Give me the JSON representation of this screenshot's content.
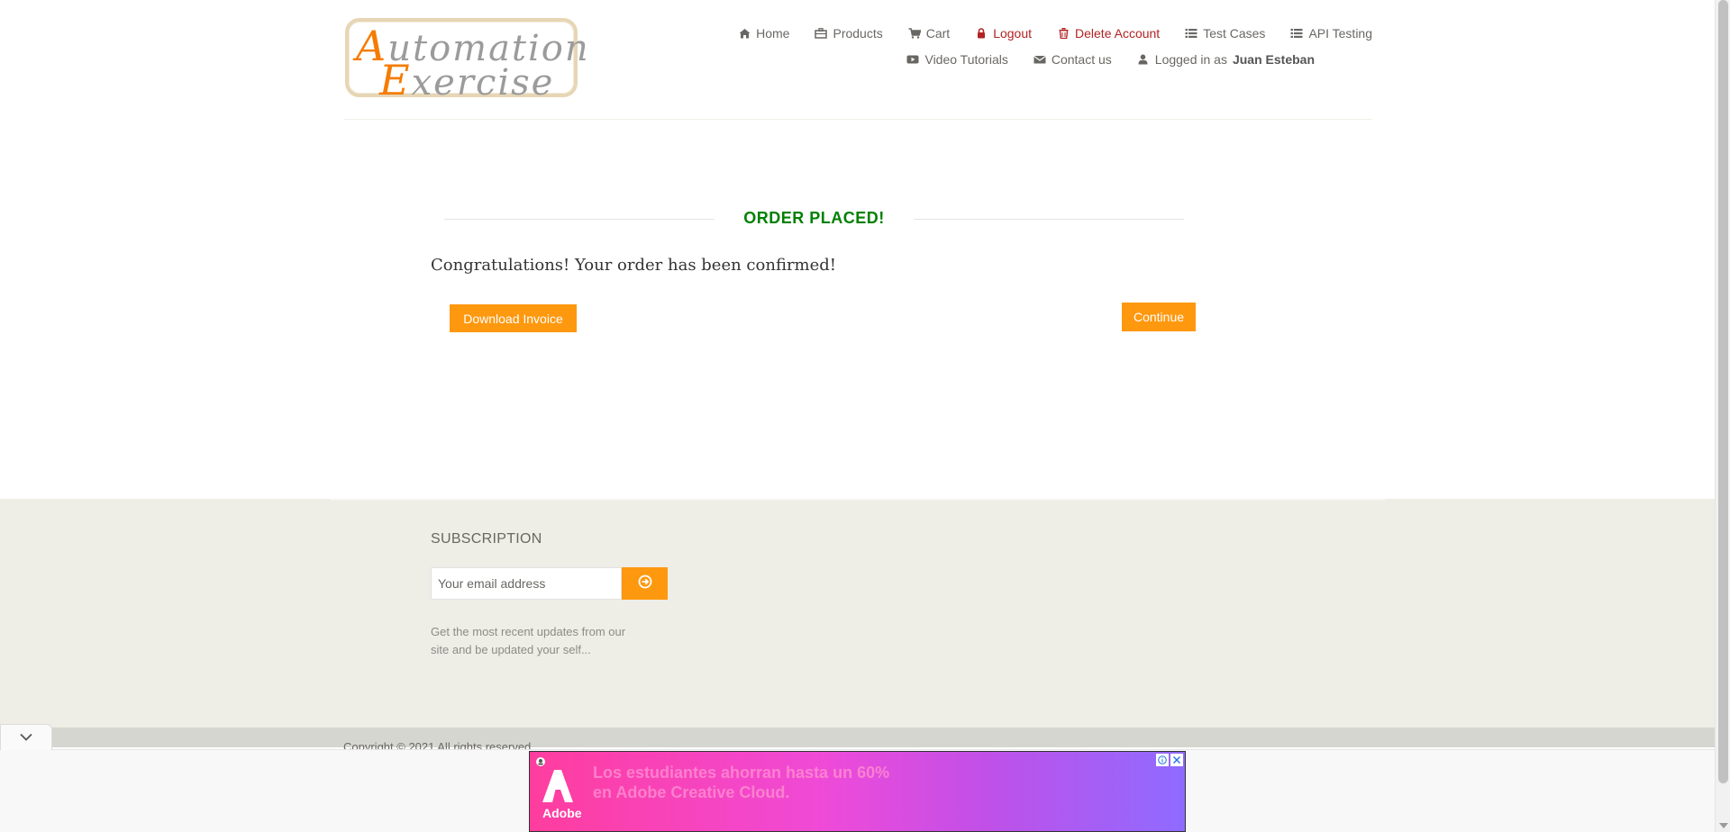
{
  "brand": {
    "logo_cap1": "A",
    "logo_rest1": "utomation",
    "logo_cap2": "E",
    "logo_rest2": "xercise"
  },
  "nav": {
    "row1": [
      {
        "label": "Home",
        "icon": "home-icon"
      },
      {
        "label": "Products",
        "icon": "products-icon"
      },
      {
        "label": "Cart",
        "icon": "cart-icon"
      },
      {
        "label": "Logout",
        "icon": "lock-icon"
      },
      {
        "label": "Delete Account",
        "icon": "trash-icon"
      },
      {
        "label": "Test Cases",
        "icon": "list-icon"
      },
      {
        "label": "API Testing",
        "icon": "list-icon"
      }
    ],
    "row2": [
      {
        "label": "Video Tutorials",
        "icon": "video-icon"
      },
      {
        "label": "Contact us",
        "icon": "envelope-icon"
      }
    ],
    "logged_prefix": "Logged in as",
    "logged_user": "Juan Esteban"
  },
  "order": {
    "title": "ORDER PLACED!",
    "message": "Congratulations! Your order has been confirmed!",
    "download_label": "Download Invoice",
    "continue_label": "Continue"
  },
  "footer": {
    "subscription_title": "SUBSCRIPTION",
    "email_placeholder": "Your email address",
    "description": "Get the most recent updates from our site and be updated your self...",
    "copyright": "Copyright © 2021 All rights reserved"
  },
  "ad": {
    "brand": "Adobe",
    "text": "Los estudiantes ahorran hasta un 60% en Adobe Creative Cloud."
  },
  "colors": {
    "accent": "#fe980f",
    "success": "#008000",
    "danger": "#b22222",
    "footer_bg": "#eeede6"
  }
}
